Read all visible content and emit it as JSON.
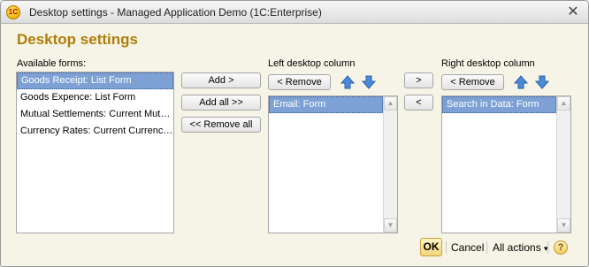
{
  "window": {
    "title": "Desktop settings - Managed Application Demo  (1C:Enterprise)",
    "logo_text": "1C",
    "close_glyph": "✕"
  },
  "heading": "Desktop settings",
  "available": {
    "label": "Available forms:",
    "items": [
      "Goods Receipt: List Form",
      "Goods Expence: List Form",
      "Mutual Settlements: Current Mutu...",
      "Currency Rates: Current Currency..."
    ],
    "selected_index": 0
  },
  "middle_buttons": {
    "add": "Add >",
    "add_all": "Add all >>",
    "remove_all": "<< Remove all"
  },
  "left_column": {
    "label": "Left desktop column",
    "remove": "< Remove",
    "items": [
      "Email: Form"
    ]
  },
  "move_buttons": {
    "right": ">",
    "left": "<"
  },
  "right_column": {
    "label": "Right desktop column",
    "remove": "< Remove",
    "items": [
      "Search in Data: Form"
    ]
  },
  "footer": {
    "ok": "OK",
    "cancel": "Cancel",
    "all_actions": "All actions",
    "dropdown_glyph": "▾",
    "help": "?"
  },
  "icons": {
    "move_up": "arrow-up-icon",
    "move_down": "arrow-down-icon"
  },
  "colors": {
    "heading": "#b07d0a",
    "selection": "#7da1d4",
    "arrow_blue": "#3f7fd0"
  }
}
